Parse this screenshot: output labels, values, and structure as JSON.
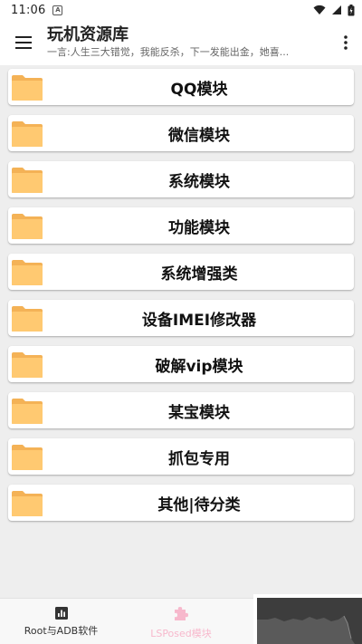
{
  "status_bar": {
    "time": "11:06",
    "notification_icon": "A"
  },
  "app_bar": {
    "title": "玩机资源库",
    "subtitle": "一言:人生三大错觉，我能反杀，下一发能出金，她喜..."
  },
  "modules": [
    {
      "label": "QQ模块"
    },
    {
      "label": "微信模块"
    },
    {
      "label": "系统模块"
    },
    {
      "label": "功能模块"
    },
    {
      "label": "系统增强类"
    },
    {
      "label": "设备IMEI修改器"
    },
    {
      "label": "破解vip模块"
    },
    {
      "label": "某宝模块"
    },
    {
      "label": "抓包专用"
    },
    {
      "label": "其他|待分类"
    }
  ],
  "bottom_nav": {
    "root_label": "Root与ADB软件",
    "lsposed_label": "LSPosed模块"
  },
  "colors": {
    "folder": "#ffc971",
    "folder_dark": "#f4b256",
    "active_tab": "#f7b8cc"
  }
}
